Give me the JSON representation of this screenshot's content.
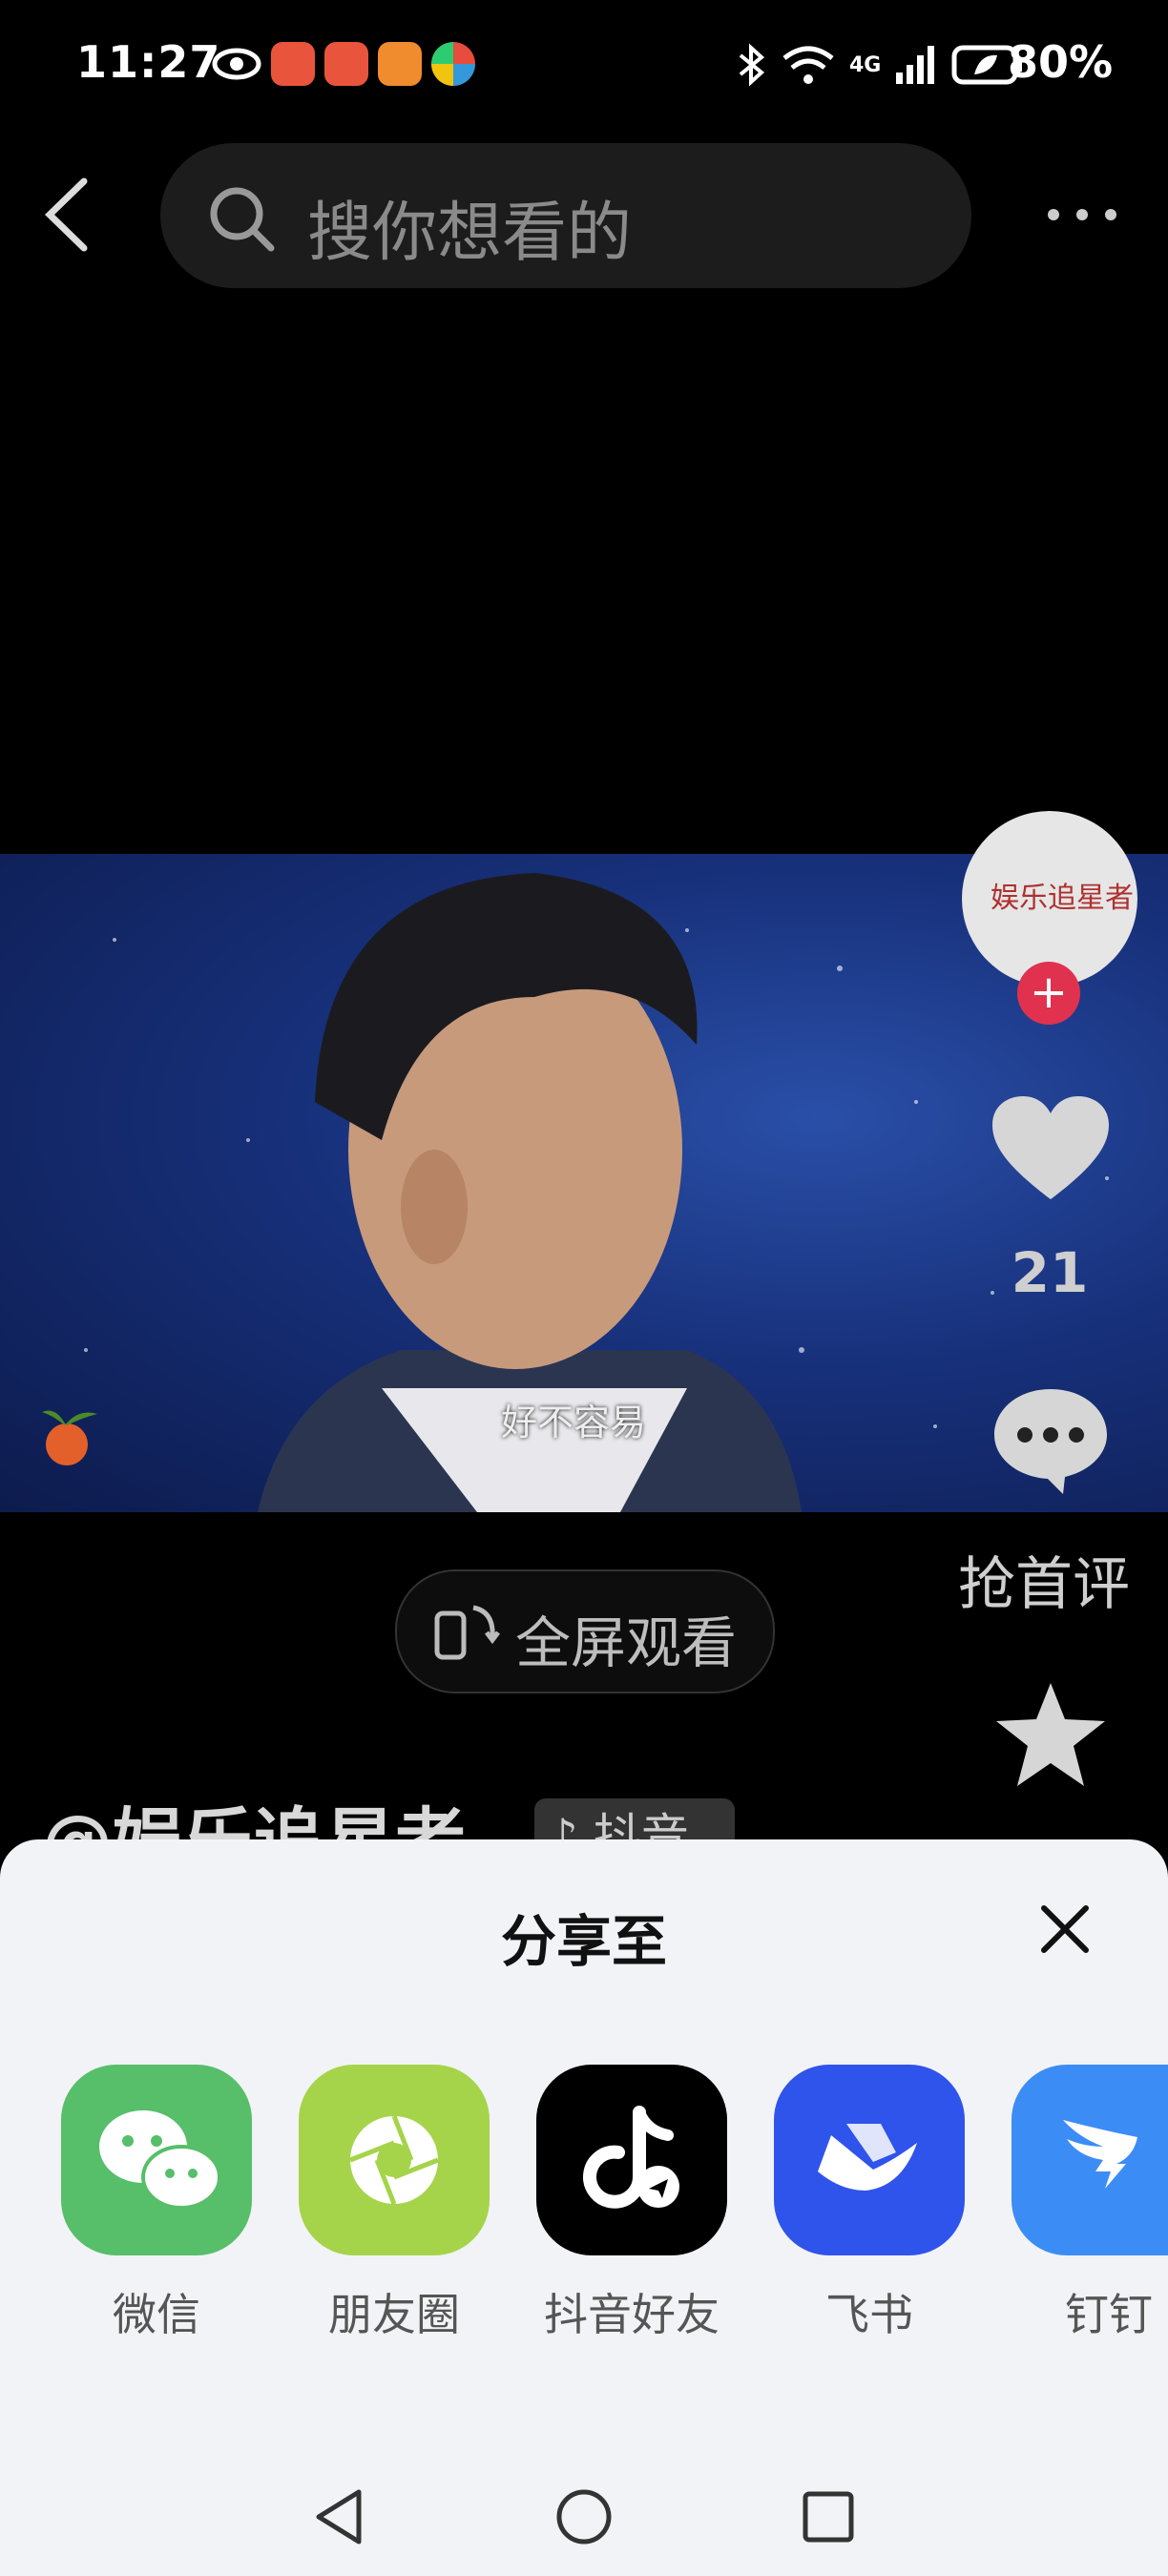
{
  "status_bar": {
    "time": "11:27",
    "network": "4G",
    "battery": "80%",
    "app_icons": [
      "eye-icon",
      "red-envelope-icon",
      "red-envelope-icon",
      "heart-app-icon",
      "pinwheel-app-icon"
    ]
  },
  "header": {
    "search_placeholder": "搜你想看的"
  },
  "video": {
    "subtitle": "好不容易",
    "avatar_text": "娱乐追星者"
  },
  "actions": {
    "like_count": "21",
    "comment_label": "抢首评",
    "fullscreen_label": "全屏观看"
  },
  "author": {
    "name": "@娱乐追星者",
    "platform": "抖音"
  },
  "share_sheet": {
    "title": "分享至",
    "items": [
      {
        "label": "微信",
        "color": "#57be6a"
      },
      {
        "label": "朋友圈",
        "color": "#a5d44a"
      },
      {
        "label": "抖音好友",
        "color": "#000000"
      },
      {
        "label": "飞书",
        "color": "#2f54eb"
      },
      {
        "label": "钉钉",
        "color": "#3c8cf6"
      }
    ]
  }
}
